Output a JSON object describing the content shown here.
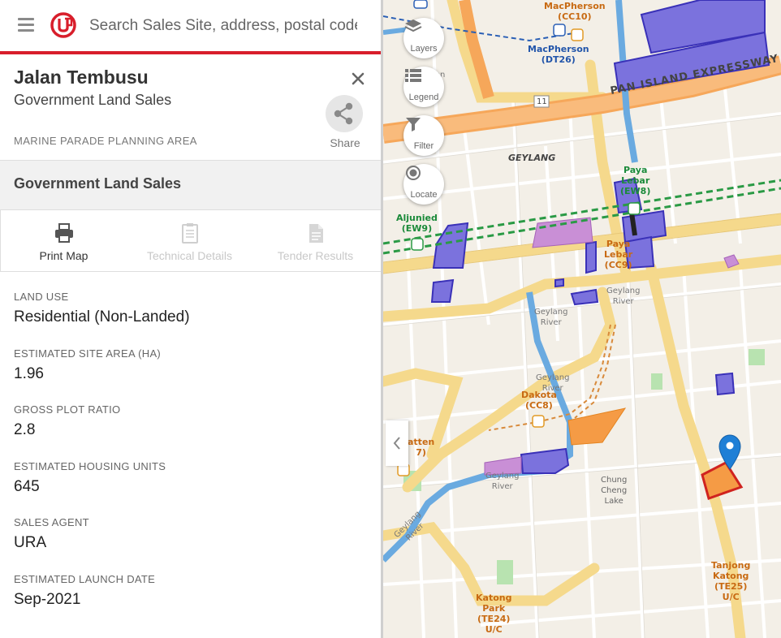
{
  "search": {
    "placeholder": "Search Sales Site, address, postal code"
  },
  "site": {
    "title": "Jalan Tembusu",
    "subtitle": "Government Land Sales",
    "planning_area": "MARINE PARADE PLANNING AREA",
    "share_label": "Share"
  },
  "section": {
    "title": "Government Land Sales"
  },
  "actions": [
    {
      "label": "Print Map",
      "icon": "printer-icon",
      "enabled": true
    },
    {
      "label": "Technical Details",
      "icon": "clipboard-icon",
      "enabled": false
    },
    {
      "label": "Tender Results",
      "icon": "document-icon",
      "enabled": false
    }
  ],
  "fields": [
    {
      "label": "LAND USE",
      "value": "Residential (Non-Landed)"
    },
    {
      "label": "ESTIMATED SITE AREA (HA)",
      "value": "1.96"
    },
    {
      "label": "GROSS PLOT RATIO",
      "value": "2.8"
    },
    {
      "label": "ESTIMATED HOUSING UNITS",
      "value": "645"
    },
    {
      "label": "SALES AGENT",
      "value": "URA"
    },
    {
      "label": "ESTIMATED LAUNCH DATE",
      "value": "Sep-2021"
    }
  ],
  "map": {
    "controls": [
      {
        "label": "Layers",
        "icon": "layers-icon"
      },
      {
        "label": "Legend",
        "icon": "legend-icon"
      },
      {
        "label": "Filter",
        "icon": "filter-icon"
      },
      {
        "label": "Locate",
        "icon": "locate-icon"
      }
    ],
    "labels": {
      "pie": "PAN ISLAND EXPRESSWAY",
      "macpherson_cc": "MacPherson\n(CC10)",
      "macpherson_dt": "MacPherson\n(DT26)",
      "geylang": "GEYLANG",
      "paya_lebar_ew": "Paya\nLebar\n(EW8)",
      "aljunied": "Aljunied\n(EW9)",
      "paya_lebar_cc": "Paya\nLebar\n(CC9)",
      "geylang_river_1": "Geylang\nRiver",
      "geylang_river_2": "Geylang\nRiver",
      "geylang_river_3": "Geylang\nRiver",
      "geylang_river_4": "Geylang\nRiver",
      "geylang_river_5": "Geylang\nRiver",
      "dakota": "Dakota\n(CC8)",
      "mountbatten": "atten\n7)",
      "chung_cheng_lake": "Chung\nCheng\nLake",
      "tanjong_katong": "Tanjong\nKatong\n(TE25)\nU/C",
      "katong_park": "Katong\nPark\n(TE24)\nU/C",
      "ulu": "ton",
      "road_11": "11"
    },
    "colors": {
      "site_fill": "#f59b45",
      "site_outline": "#d0231f",
      "gls_purple": "#7b72dd",
      "pin": "#1f7fd6"
    }
  }
}
